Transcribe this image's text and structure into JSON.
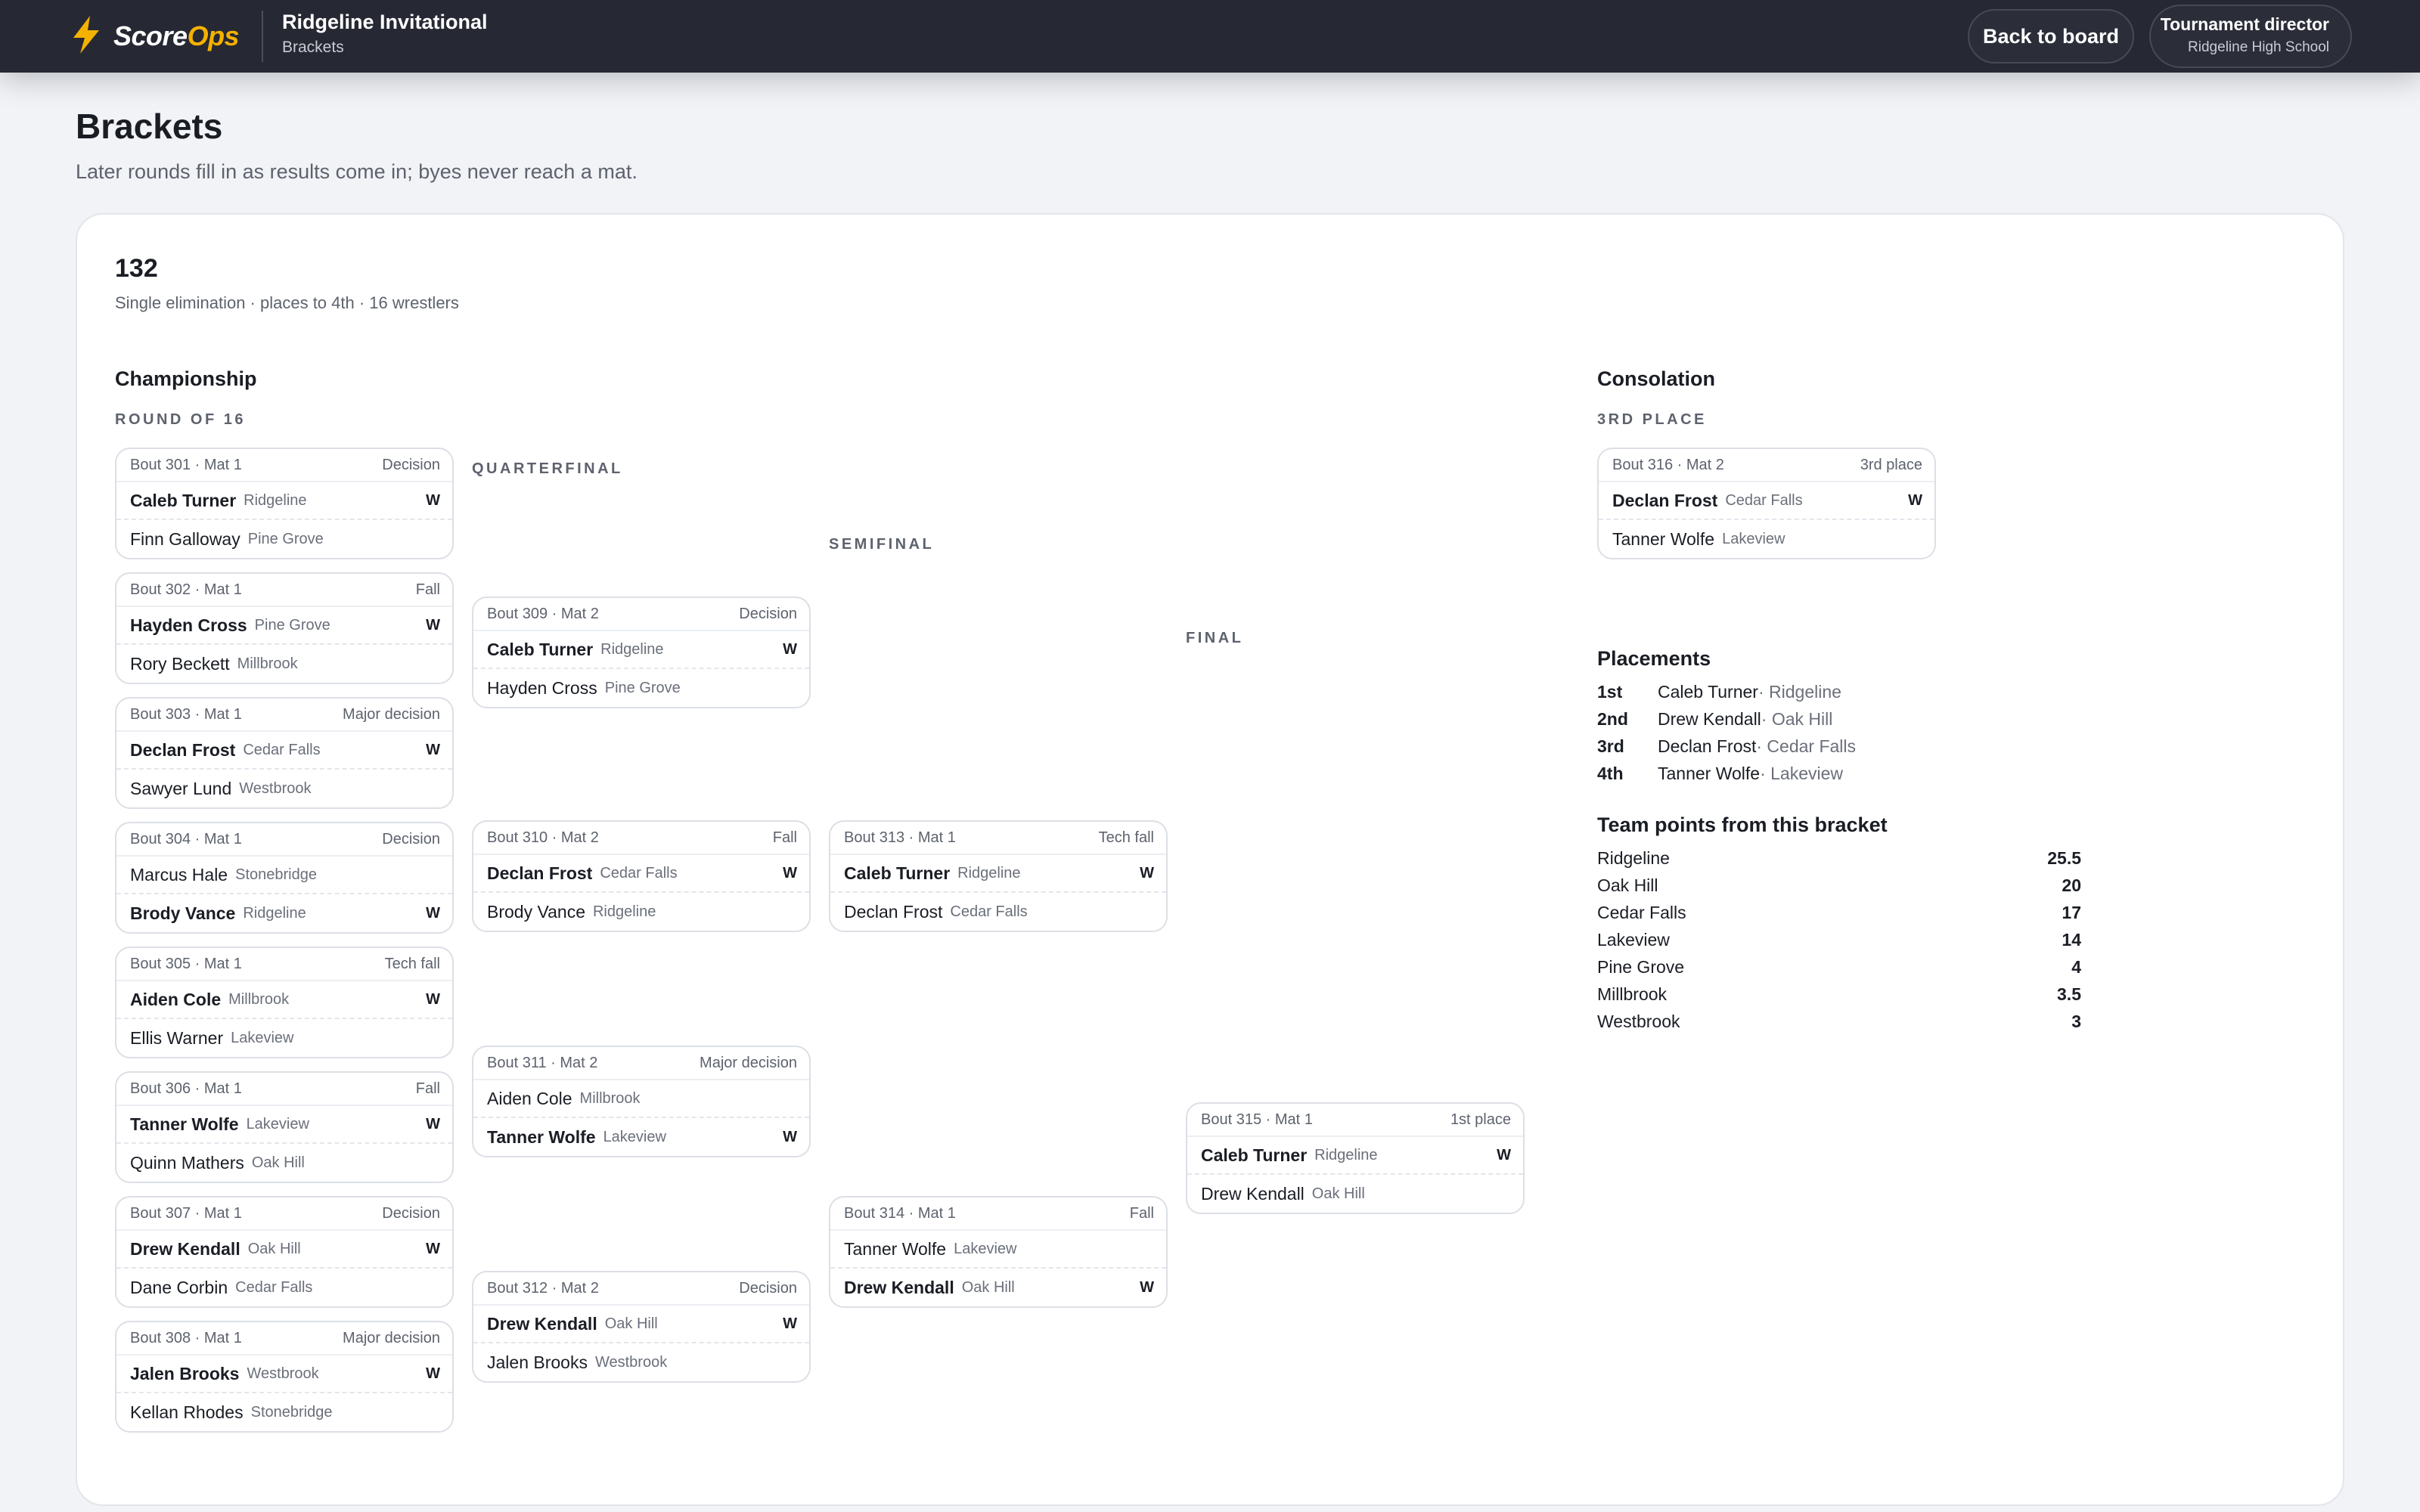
{
  "brand": {
    "name_part1": "Score",
    "name_part2": "Ops",
    "accent_color": "#f5b100",
    "icon": "lightning-bolt-icon"
  },
  "header": {
    "event_title": "Ridgeline Invitational",
    "event_sub": "Brackets",
    "back_button": "Back to board",
    "user_role": "Tournament director",
    "user_org": "Ridgeline High School"
  },
  "page": {
    "title": "Brackets",
    "subtitle": "Later rounds fill in as results come in; byes never reach a mat."
  },
  "bracket": {
    "weight": "132",
    "meta": "Single elimination · places to 4th · 16 wrestlers",
    "championship_title": "Championship",
    "consolation_title": "Consolation",
    "rounds": {
      "r16": "ROUND OF 16",
      "qf": "QUARTERFINAL",
      "sf": "SEMIFINAL",
      "final": "FINAL",
      "third": "3RD PLACE"
    },
    "win_mark": "W",
    "bouts": [
      {
        "label": "Bout 301 · Mat 1",
        "result": "Decision",
        "a_name": "Caleb Turner",
        "a_team": "Ridgeline",
        "b_name": "Finn Galloway",
        "b_team": "Pine Grove",
        "winner": "a"
      },
      {
        "label": "Bout 302 · Mat 1",
        "result": "Fall",
        "a_name": "Hayden Cross",
        "a_team": "Pine Grove",
        "b_name": "Rory Beckett",
        "b_team": "Millbrook",
        "winner": "a"
      },
      {
        "label": "Bout 303 · Mat 1",
        "result": "Major decision",
        "a_name": "Declan Frost",
        "a_team": "Cedar Falls",
        "b_name": "Sawyer Lund",
        "b_team": "Westbrook",
        "winner": "a"
      },
      {
        "label": "Bout 304 · Mat 1",
        "result": "Decision",
        "a_name": "Marcus Hale",
        "a_team": "Stonebridge",
        "b_name": "Brody Vance",
        "b_team": "Ridgeline",
        "winner": "b"
      },
      {
        "label": "Bout 305 · Mat 1",
        "result": "Tech fall",
        "a_name": "Aiden Cole",
        "a_team": "Millbrook",
        "b_name": "Ellis Warner",
        "b_team": "Lakeview",
        "winner": "a"
      },
      {
        "label": "Bout 306 · Mat 1",
        "result": "Fall",
        "a_name": "Tanner Wolfe",
        "a_team": "Lakeview",
        "b_name": "Quinn Mathers",
        "b_team": "Oak Hill",
        "winner": "a"
      },
      {
        "label": "Bout 307 · Mat 1",
        "result": "Decision",
        "a_name": "Drew Kendall",
        "a_team": "Oak Hill",
        "b_name": "Dane Corbin",
        "b_team": "Cedar Falls",
        "winner": "a"
      },
      {
        "label": "Bout 308 · Mat 1",
        "result": "Major decision",
        "a_name": "Jalen Brooks",
        "a_team": "Westbrook",
        "b_name": "Kellan Rhodes",
        "b_team": "Stonebridge",
        "winner": "a"
      },
      {
        "label": "Bout 309 · Mat 2",
        "result": "Decision",
        "a_name": "Caleb Turner",
        "a_team": "Ridgeline",
        "b_name": "Hayden Cross",
        "b_team": "Pine Grove",
        "winner": "a"
      },
      {
        "label": "Bout 310 · Mat 2",
        "result": "Fall",
        "a_name": "Declan Frost",
        "a_team": "Cedar Falls",
        "b_name": "Brody Vance",
        "b_team": "Ridgeline",
        "winner": "a"
      },
      {
        "label": "Bout 311 · Mat 2",
        "result": "Major decision",
        "a_name": "Aiden Cole",
        "a_team": "Millbrook",
        "b_name": "Tanner Wolfe",
        "b_team": "Lakeview",
        "winner": "b"
      },
      {
        "label": "Bout 312 · Mat 2",
        "result": "Decision",
        "a_name": "Drew Kendall",
        "a_team": "Oak Hill",
        "b_name": "Jalen Brooks",
        "b_team": "Westbrook",
        "winner": "a"
      },
      {
        "label": "Bout 313 · Mat 1",
        "result": "Tech fall",
        "a_name": "Caleb Turner",
        "a_team": "Ridgeline",
        "b_name": "Declan Frost",
        "b_team": "Cedar Falls",
        "winner": "a"
      },
      {
        "label": "Bout 314 · Mat 1",
        "result": "Fall",
        "a_name": "Tanner Wolfe",
        "a_team": "Lakeview",
        "b_name": "Drew Kendall",
        "b_team": "Oak Hill",
        "winner": "b"
      },
      {
        "label": "Bout 315 · Mat 1",
        "result": "1st place",
        "a_name": "Caleb Turner",
        "a_team": "Ridgeline",
        "b_name": "Drew Kendall",
        "b_team": "Oak Hill",
        "winner": "a"
      },
      {
        "label": "Bout 316 · Mat 2",
        "result": "3rd place",
        "a_name": "Declan Frost",
        "a_team": "Cedar Falls",
        "b_name": "Tanner Wolfe",
        "b_team": "Lakeview",
        "winner": "a"
      }
    ]
  },
  "placements": {
    "title": "Placements",
    "items": [
      {
        "rank": "1st",
        "name": "Caleb Turner",
        "team": " · Ridgeline"
      },
      {
        "rank": "2nd",
        "name": "Drew Kendall",
        "team": " · Oak Hill"
      },
      {
        "rank": "3rd",
        "name": "Declan Frost",
        "team": " · Cedar Falls"
      },
      {
        "rank": "4th",
        "name": "Tanner Wolfe",
        "team": " · Lakeview"
      }
    ]
  },
  "team_points": {
    "title": "Team points from this bracket",
    "items": [
      {
        "team": "Ridgeline",
        "points": "25.5"
      },
      {
        "team": "Oak Hill",
        "points": "20"
      },
      {
        "team": "Cedar Falls",
        "points": "17"
      },
      {
        "team": "Lakeview",
        "points": "14"
      },
      {
        "team": "Pine Grove",
        "points": "4"
      },
      {
        "team": "Millbrook",
        "points": "3.5"
      },
      {
        "team": "Westbrook",
        "points": "3"
      }
    ]
  }
}
